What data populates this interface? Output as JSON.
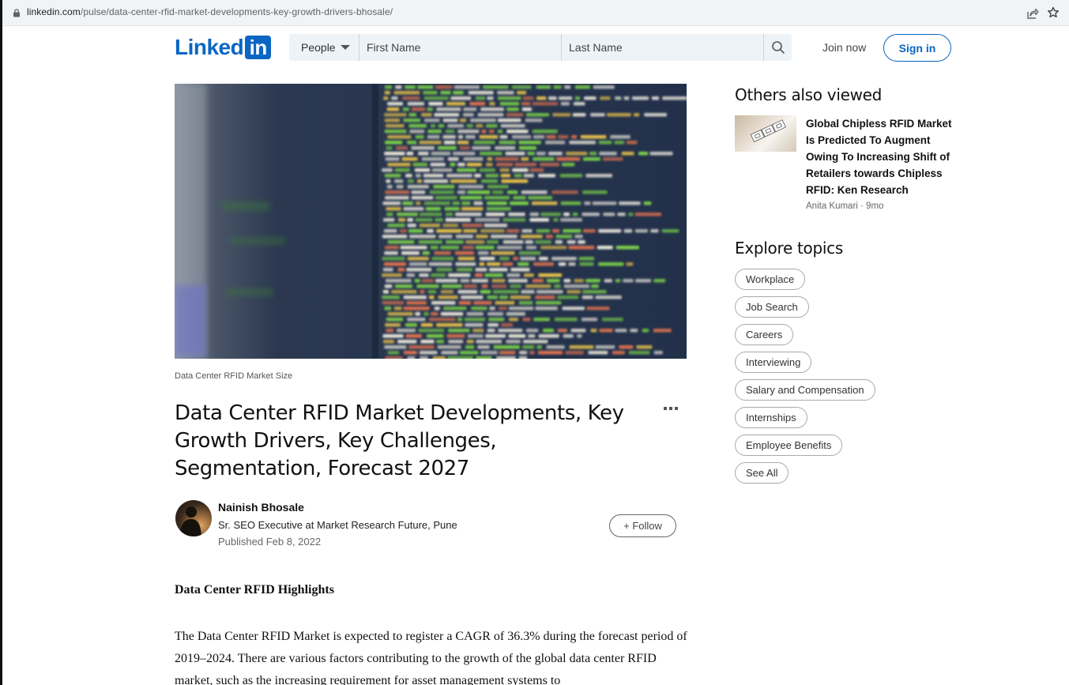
{
  "browser": {
    "url_host": "linkedin.com",
    "url_path": "/pulse/data-center-rfid-market-developments-key-growth-drivers-bhosale/",
    "icons": [
      "lock-icon",
      "share-icon",
      "star-icon"
    ]
  },
  "header": {
    "logo_word": "Linked",
    "logo_box": "in",
    "search": {
      "category": "People",
      "first_name_placeholder": "First Name",
      "last_name_placeholder": "Last Name"
    },
    "join_label": "Join now",
    "signin_label": "Sign in",
    "brand_color": "#0a66c2"
  },
  "article": {
    "image_caption": "Data Center RFID Market Size",
    "title": "Data Center RFID Market Developments, Key Growth Drivers, Key Challenges, Segmentation, Forecast 2027",
    "author": {
      "name": "Nainish Bhosale",
      "headline": "Sr. SEO Executive at Market Research Future, Pune",
      "published": "Published Feb 8, 2022"
    },
    "follow_label": "+ Follow",
    "body_heading": "Data Center RFID Highlights",
    "body_paragraph": "The Data Center RFID Market is expected to register a CAGR of 36.3% during the forecast period of 2019–2024. There are various factors contributing to the growth of the global data center RFID market, such as the increasing requirement for asset management systems to"
  },
  "sidebar": {
    "others_heading": "Others also viewed",
    "others": [
      {
        "title": "Global Chipless RFID Market Is Predicted To Augment Owing To Increasing Shift of Retailers towards Chipless RFID: Ken Research",
        "meta": "Anita Kumari · 9mo"
      }
    ],
    "topics_heading": "Explore topics",
    "topics": [
      "Workplace",
      "Job Search",
      "Careers",
      "Interviewing",
      "Salary and Compensation",
      "Internships",
      "Employee Benefits",
      "See All"
    ]
  }
}
